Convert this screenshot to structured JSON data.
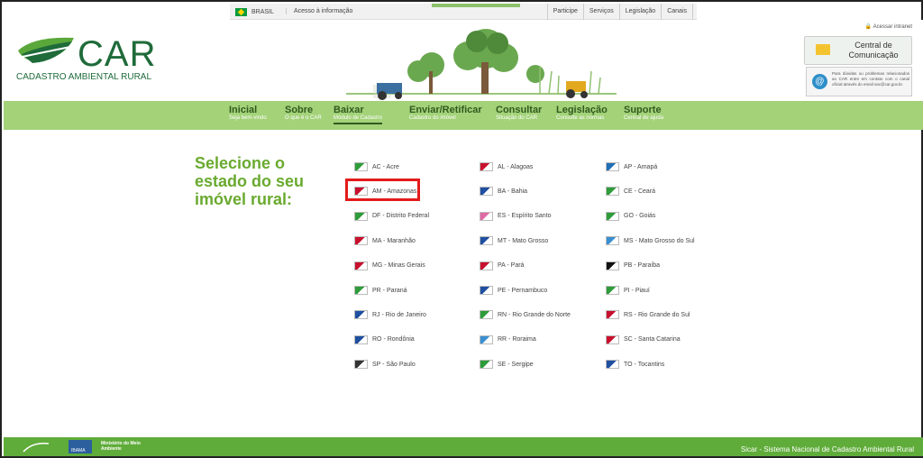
{
  "govbar": {
    "brasil": "BRASIL",
    "acesso": "Acesso à informação",
    "links": [
      "Participe",
      "Serviços",
      "Legislação",
      "Canais"
    ]
  },
  "header": {
    "logo_title": "CAR",
    "logo_subtitle": "CADASTRO AMBIENTAL RURAL",
    "intranet": "Acessar intranet",
    "central": "Central de Comunicação",
    "sac_text": "Para dúvidas ou problemas relacionados ao CAR entre em contato com o canal oficial através do email sac@car.gov.br."
  },
  "nav": [
    {
      "title": "Inicial",
      "sub": "Seja bem-vindo"
    },
    {
      "title": "Sobre",
      "sub": "O que é o CAR"
    },
    {
      "title": "Baixar",
      "sub": "Módulo de Cadastro"
    },
    {
      "title": "Enviar/Retificar",
      "sub": "Cadastro do imóvel"
    },
    {
      "title": "Consultar",
      "sub": "Situação do CAR"
    },
    {
      "title": "Legislação",
      "sub": "Consulte as normas"
    },
    {
      "title": "Suporte",
      "sub": "Central de ajuda"
    }
  ],
  "main": {
    "title": "Selecione o estado do seu imóvel rural:"
  },
  "states": [
    {
      "label": "AC - Acre",
      "color": "#2e9c3a"
    },
    {
      "label": "AL - Alagoas",
      "color": "#c8102e"
    },
    {
      "label": "AP - Amapá",
      "color": "#1f6fb5"
    },
    {
      "label": "AM - Amazonas",
      "color": "#c8102e"
    },
    {
      "label": "BA - Bahia",
      "color": "#1f4fa0"
    },
    {
      "label": "CE - Ceará",
      "color": "#2e9c3a"
    },
    {
      "label": "DF - Distrito Federal",
      "color": "#2e9c3a"
    },
    {
      "label": "ES - Espírito Santo",
      "color": "#e06aa5"
    },
    {
      "label": "GO - Goiás",
      "color": "#2e9c3a"
    },
    {
      "label": "MA - Maranhão",
      "color": "#c8102e"
    },
    {
      "label": "MT - Mato Grosso",
      "color": "#1f4fa0"
    },
    {
      "label": "MS - Mato Grosso do Sul",
      "color": "#3a8fd0"
    },
    {
      "label": "MG - Minas Gerais",
      "color": "#c8102e"
    },
    {
      "label": "PA - Pará",
      "color": "#c8102e"
    },
    {
      "label": "PB - Paraíba",
      "color": "#111111"
    },
    {
      "label": "PR - Paraná",
      "color": "#2e9c3a"
    },
    {
      "label": "PE - Pernambuco",
      "color": "#1f4fa0"
    },
    {
      "label": "PI - Piauí",
      "color": "#2e9c3a"
    },
    {
      "label": "RJ - Rio de Janeiro",
      "color": "#1f4fa0"
    },
    {
      "label": "RN - Rio Grande do Norte",
      "color": "#2e9c3a"
    },
    {
      "label": "RS - Rio Grande do Sul",
      "color": "#c8102e"
    },
    {
      "label": "RO - Rondônia",
      "color": "#1f4fa0"
    },
    {
      "label": "RR - Roraima",
      "color": "#3a8fd0"
    },
    {
      "label": "SC - Santa Catarina",
      "color": "#c8102e"
    },
    {
      "label": "SP - São Paulo",
      "color": "#333333"
    },
    {
      "label": "SE - Sergipe",
      "color": "#2e9c3a"
    },
    {
      "label": "TO - Tocantins",
      "color": "#1f4fa0"
    }
  ],
  "footer": {
    "ministerio": "Ministério do Meio Ambiente",
    "ibama": "IBAMA",
    "sicar": "Sicar - Sistema Nacional de Cadastro Ambiental Rural"
  }
}
